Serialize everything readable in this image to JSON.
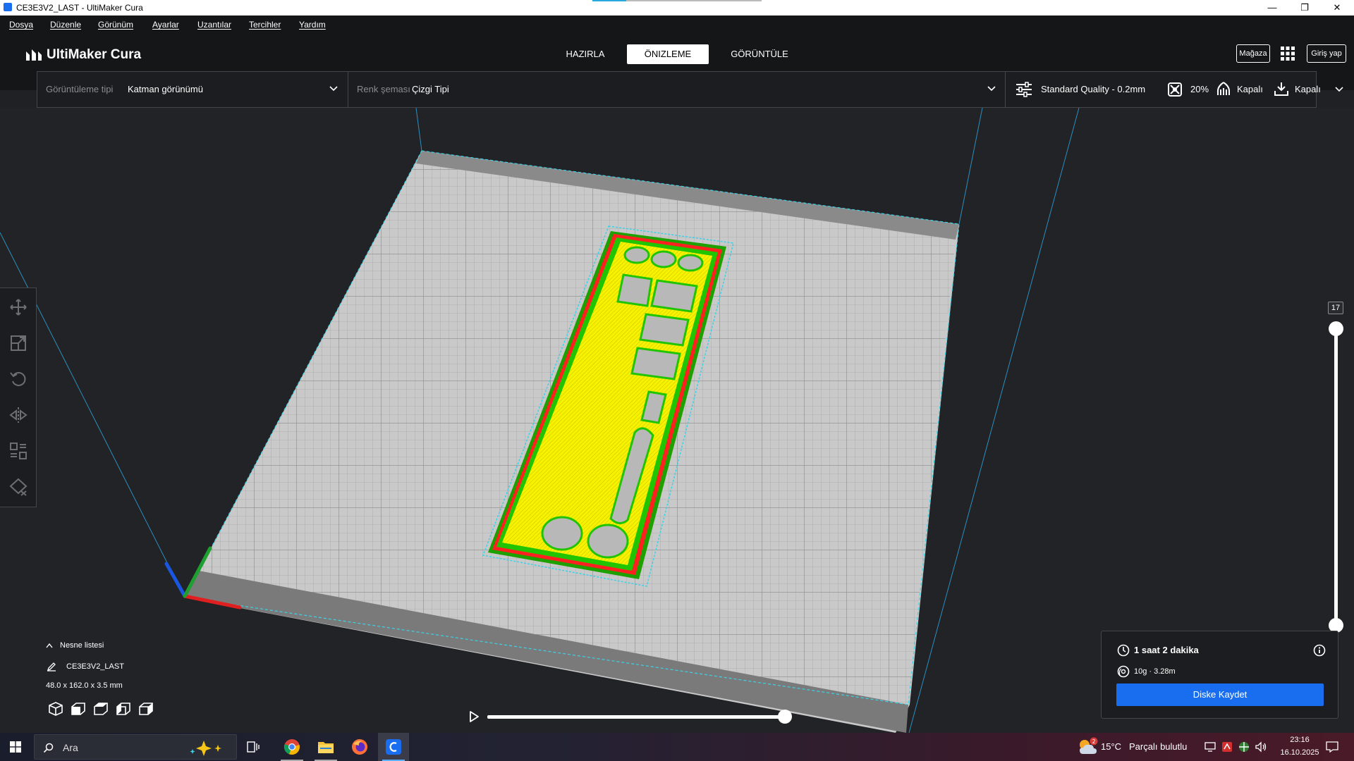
{
  "window": {
    "title": "CE3E3V2_LAST - UltiMaker Cura"
  },
  "menu": [
    "Dosya",
    "Düzenle",
    "Görünüm",
    "Ayarlar",
    "Uzantılar",
    "Tercihler",
    "Yardım"
  ],
  "header": {
    "logo": "UltiMaker Cura",
    "tabs": [
      "HAZIRLA",
      "ÖNIZLEME",
      "GÖRÜNTÜLE"
    ],
    "active_tab": "ÖNIZLEME",
    "store_button": "Mağaza",
    "login_button": "Giriş yap"
  },
  "toolbar": {
    "view_type_label": "Görüntüleme tipi",
    "view_type_value": "Katman görünümü",
    "color_scheme_label": "Renk şeması",
    "color_scheme_value": "Çizgi Tipi",
    "quality": "Standard Quality - 0.2mm",
    "infill": "20%",
    "support": "Kapalı",
    "adhesion": "Kapalı"
  },
  "layer_slider": {
    "current_layer": "17"
  },
  "object_list": {
    "toggle_label": "Nesne listesi",
    "object_name": "CE3E3V2_LAST",
    "dimensions": "48.0 x 162.0 x 3.5 mm"
  },
  "print_info": {
    "time": "1 saat 2 dakika",
    "material": "10g · 3.28m",
    "save_button": "Diske Kaydet"
  },
  "simulation": {
    "progress": 1.0
  },
  "taskbar": {
    "search_placeholder": "Ara",
    "weather_temp": "15°C",
    "weather_desc": "Parçalı bulutlu",
    "weather_badge": "2",
    "time": "23:16",
    "date": "16.10.2025"
  },
  "colors": {
    "accent": "#196ef0",
    "wall_outer": "#ff1f1f",
    "wall_inner": "#21c400",
    "skin": "#ffff00",
    "skirt": "#3ad3e8",
    "background": "#222326"
  }
}
